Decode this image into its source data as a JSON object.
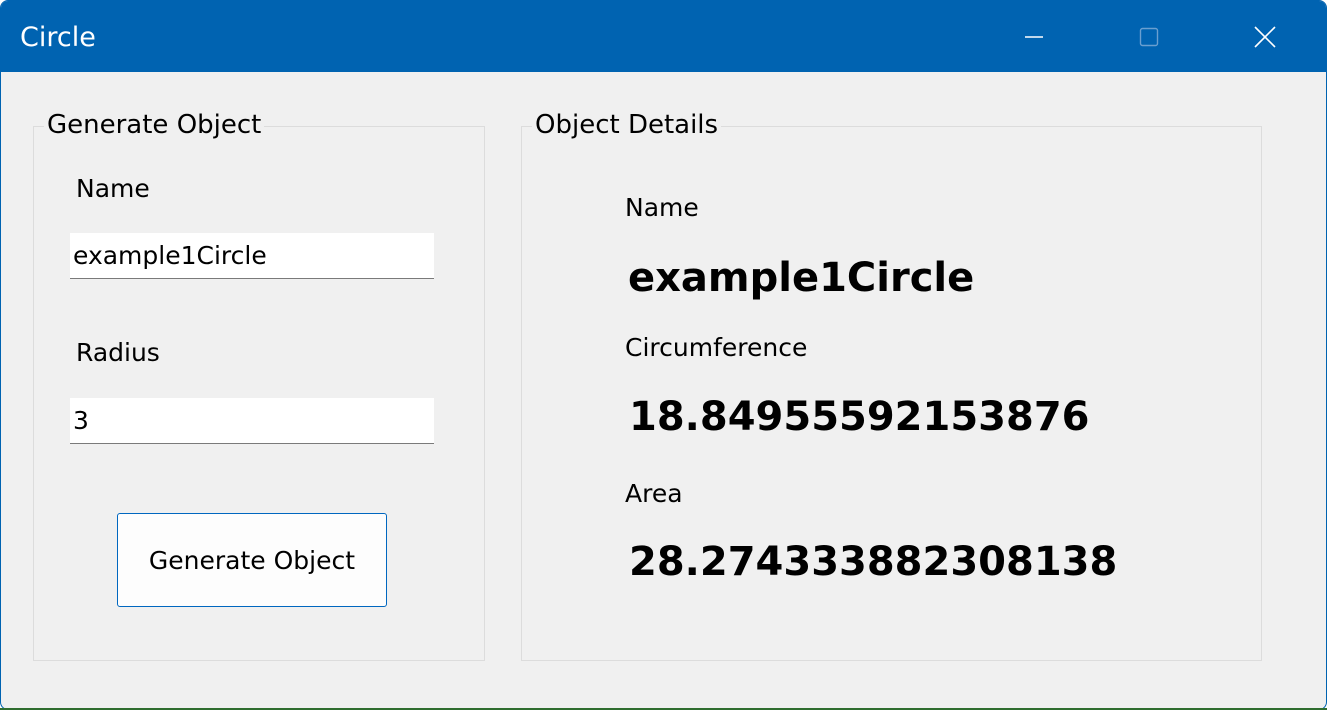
{
  "window": {
    "title": "Circle",
    "accent_color": "#0063b1",
    "controls": {
      "minimize_icon": "minimize-icon",
      "maximize_icon": "maximize-icon",
      "close_icon": "close-icon"
    }
  },
  "generate_group": {
    "legend": "Generate Object",
    "name_label": "Name",
    "name_value": "example1Circle",
    "radius_label": "Radius",
    "radius_value": "3",
    "button_label": "Generate Object"
  },
  "details_group": {
    "legend": "Object Details",
    "name_label": "Name",
    "name_value": "example1Circle",
    "circumference_label": "Circumference",
    "circumference_value": "18.84955592153876",
    "area_label": "Area",
    "area_value": "28.274333882308138"
  }
}
